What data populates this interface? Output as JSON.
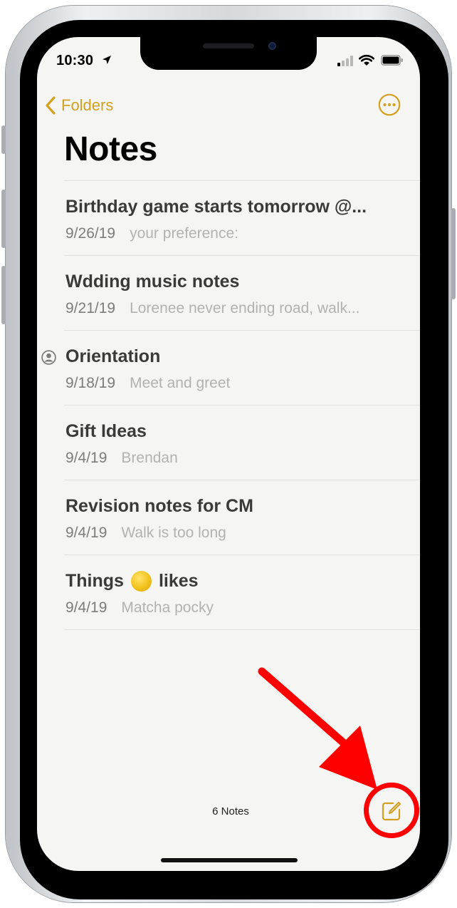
{
  "status_bar": {
    "time": "10:30",
    "icons": [
      "location-arrow-icon",
      "cellular-signal-icon",
      "wifi-icon",
      "battery-icon"
    ]
  },
  "nav": {
    "back_label": "Folders",
    "back_icon": "chevron-left-icon",
    "more_icon": "ellipsis-circle-icon"
  },
  "title": "Notes",
  "notes": [
    {
      "title": "Birthday game starts tomorrow @...",
      "date": "9/26/19",
      "preview": "your preference:",
      "shared": false
    },
    {
      "title": "Wdding music notes",
      "date": "9/21/19",
      "preview": "Lorenee never ending road, walk...",
      "shared": false
    },
    {
      "title": "Orientation",
      "date": "9/18/19",
      "preview": "Meet and greet",
      "shared": true
    },
    {
      "title": "Gift Ideas",
      "date": "9/4/19",
      "preview": "Brendan",
      "shared": false
    },
    {
      "title": "Revision notes for CM",
      "date": "9/4/19",
      "preview": "Walk is too long",
      "shared": false
    },
    {
      "title_before": "Things",
      "title_emoji": "yellow-face-emoji-icon",
      "title_after": "likes",
      "date": "9/4/19",
      "preview": "Matcha pocky",
      "shared": false
    }
  ],
  "toolbar": {
    "count": "6 Notes",
    "compose_icon": "compose-icon"
  },
  "colors": {
    "accent": "#d3a020",
    "annotation": "#ff0000",
    "background": "#f5f5f4"
  }
}
